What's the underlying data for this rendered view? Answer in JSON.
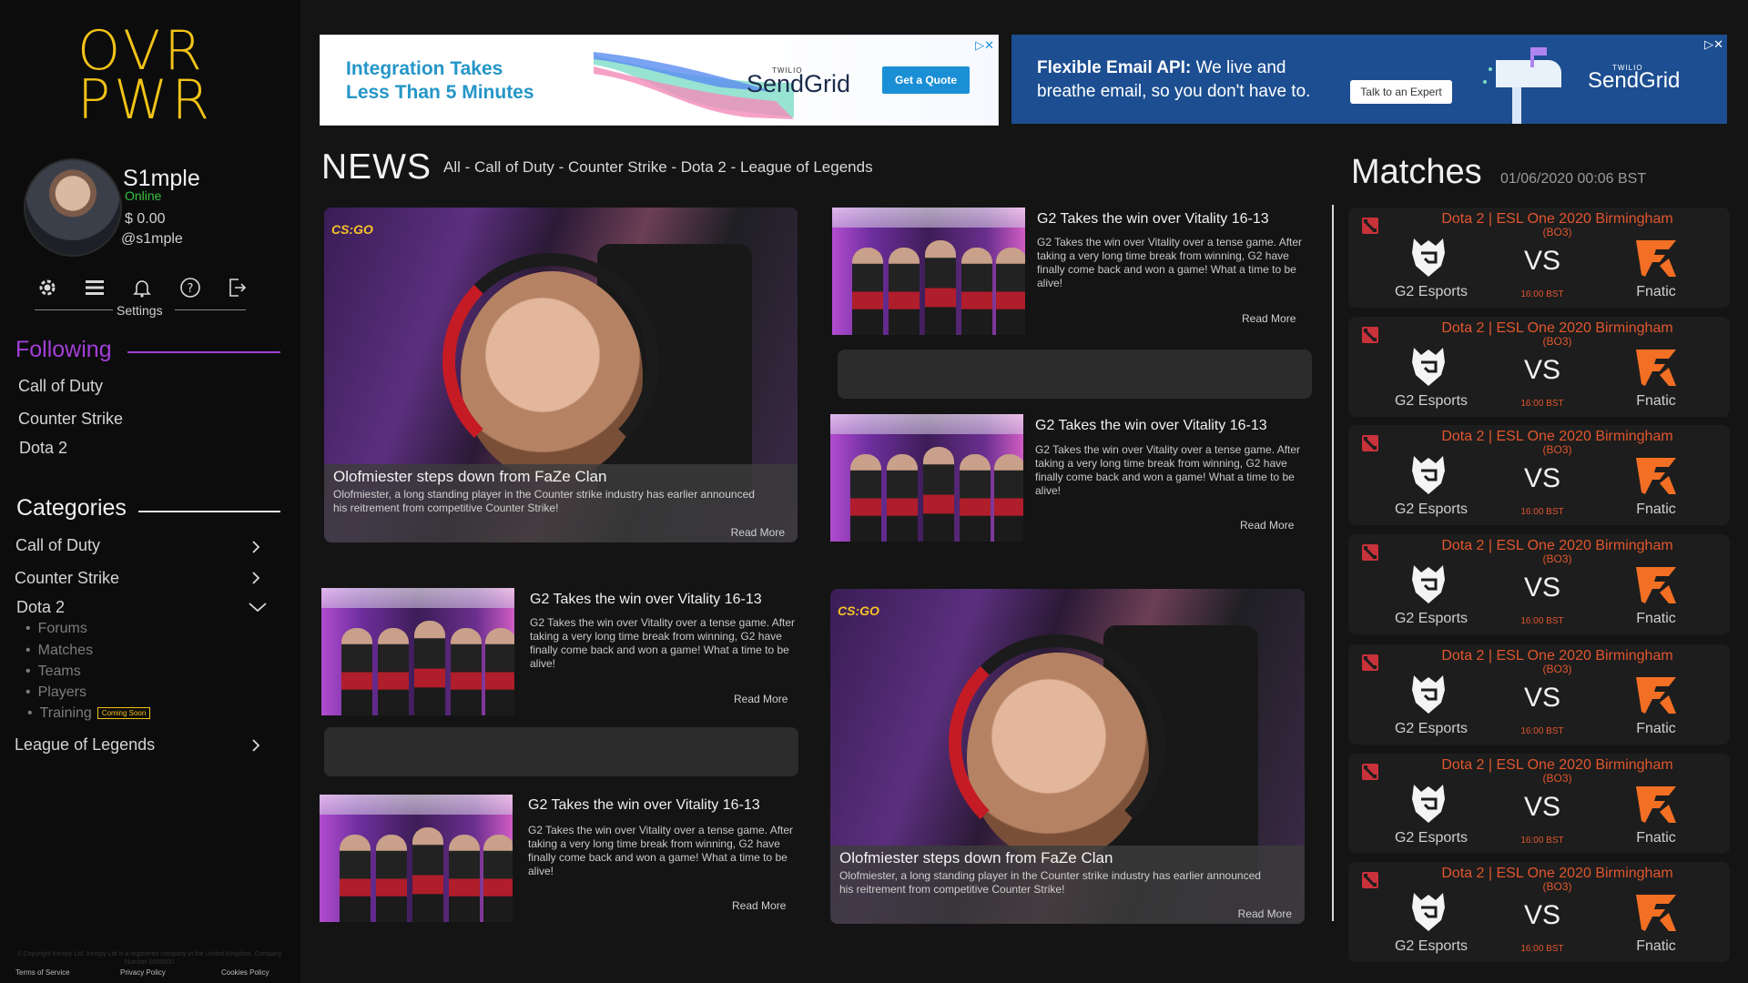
{
  "app": {
    "logo_line1": "OVR",
    "logo_line2": "PWR"
  },
  "user": {
    "name": "S1mple",
    "status": "Online",
    "balance": "$ 0.00",
    "handle": "@s1mple"
  },
  "toolbar": {
    "icons": [
      "gear-icon",
      "menu-icon",
      "bell-icon",
      "help-icon",
      "logout-icon"
    ],
    "settings_label": "Settings"
  },
  "following": {
    "heading": "Following",
    "items": [
      "Call of Duty",
      "Counter Strike",
      "Dota 2"
    ]
  },
  "categories": {
    "heading": "Categories",
    "items": [
      {
        "label": "Call of Duty"
      },
      {
        "label": "Counter Strike"
      },
      {
        "label": "Dota 2",
        "expanded": true,
        "sub": [
          "Forums",
          "Matches",
          "Teams",
          "Players",
          "Training"
        ],
        "badge": "Coming Soon"
      },
      {
        "label": "League of Legends"
      }
    ]
  },
  "footer": {
    "fine_print": "© Copyright Kempy Ltd. Kempy Ltd is a registered company in the United Kingdom. Company Number 0000000",
    "links": [
      "Terms of Service",
      "Privacy Policy",
      "Cookies Policy"
    ]
  },
  "ads": [
    {
      "headline_line1": "Integration Takes",
      "headline_line2": "Less Than 5 Minutes",
      "brand_small": "TWILIO",
      "brand": "SendGrid",
      "cta": "Get a Quote"
    },
    {
      "headline_bold": "Flexible Email API:",
      "headline_rest": " We live and",
      "headline_line2": "breathe email, so you don't have to.",
      "cta": "Talk to an Expert",
      "brand_small": "TWILIO",
      "brand": "SendGrid"
    }
  ],
  "news": {
    "title": "NEWS",
    "filters": [
      "All",
      "Call of Duty",
      "Counter Strike",
      "Dota 2",
      "League of Legends"
    ],
    "separator": " - ",
    "feature_badge": "CS:GO",
    "feature": {
      "title": "Olofmiester steps down from FaZe Clan",
      "desc": "Olofmiester, a long standing player in the Counter strike industry has earlier announced his reitrement from competitive Counter Strike!",
      "more": "Read More"
    },
    "card": {
      "title": "G2 Takes the win over Vitality 16-13",
      "desc": "G2 Takes the win over Vitality over a tense game. After taking a very long time break from winning, G2 have finally come back and won a game! What a time to be alive!",
      "more": "Read More"
    }
  },
  "matches": {
    "title": "Matches",
    "datetime": "01/06/2020 00:06 BST",
    "item": {
      "event": "Dota 2 | ESL One 2020 Birmingham",
      "format": "(BO3)",
      "team1": "G2 Esports",
      "team2": "Fnatic",
      "vs": "VS",
      "time": "16:00 BST"
    },
    "count": 7
  },
  "colors": {
    "brand_yellow": "#f2c318",
    "accent_purple": "#a33fd6",
    "online_green": "#36c23a",
    "match_orange": "#e0562e",
    "dota_red": "#c8323a"
  }
}
